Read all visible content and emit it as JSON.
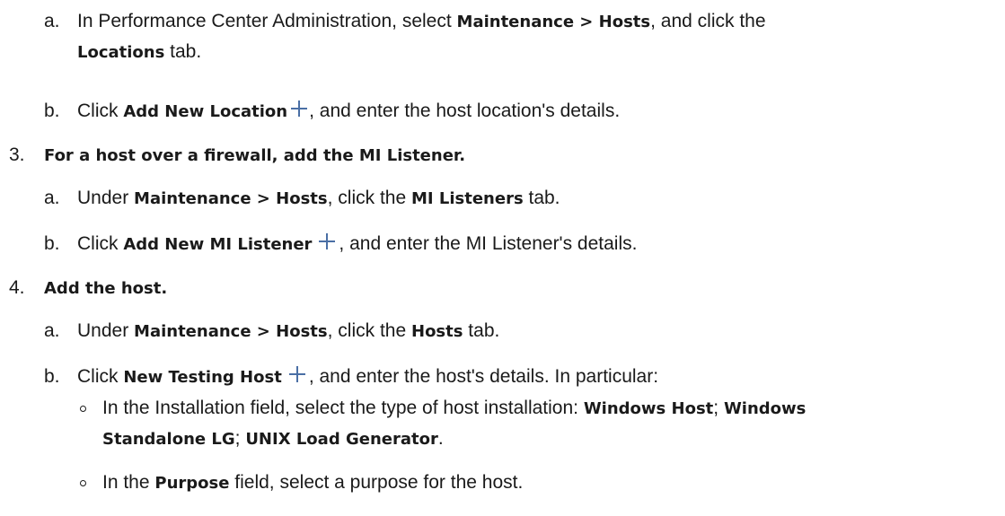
{
  "step_2a": {
    "marker": "a.",
    "text_1": "In Performance Center Administration, select ",
    "bold_1": "Maintenance > Hosts",
    "text_2": ", and click the",
    "bold_2": "Locations",
    "text_3": " tab."
  },
  "step_2b": {
    "marker": "b.",
    "text_1": "Click ",
    "bold_1": "Add New Location",
    "text_2": ", and enter the host location's details."
  },
  "step_3": {
    "marker": "3.",
    "heading": "For a host over a firewall, add the MI Listener."
  },
  "step_3a": {
    "marker": "a.",
    "text_1": "Under ",
    "bold_1": "Maintenance > Hosts",
    "text_2": ", click the ",
    "bold_2": "MI Listeners",
    "text_3": " tab."
  },
  "step_3b": {
    "marker": "b.",
    "text_1": "Click ",
    "bold_1": "Add New MI Listener",
    "text_2": ", and enter the MI Listener's details."
  },
  "step_4": {
    "marker": "4.",
    "heading": "Add the host."
  },
  "step_4a": {
    "marker": "a.",
    "text_1": "Under ",
    "bold_1": "Maintenance > Hosts",
    "text_2": ", click the ",
    "bold_2": "Hosts",
    "text_3": " tab."
  },
  "step_4b": {
    "marker": "b.",
    "text_1": "Click ",
    "bold_1": "New Testing Host",
    "text_2": ", and enter the host's details. In particular:"
  },
  "bullet_1": {
    "text_1": "In the Installation field, select the type of host installation: ",
    "bold_1": "Windows Host",
    "text_2": "; ",
    "bold_2": "Windows",
    "bold_3": "Standalone LG",
    "text_3": "; ",
    "bold_4": "UNIX Load Generator",
    "text_4": "."
  },
  "bullet_2": {
    "text_1": "In the ",
    "bold_1": "Purpose",
    "text_2": " field, select a purpose for the host."
  },
  "icons": {
    "plus_color": "#4a6fa5"
  }
}
